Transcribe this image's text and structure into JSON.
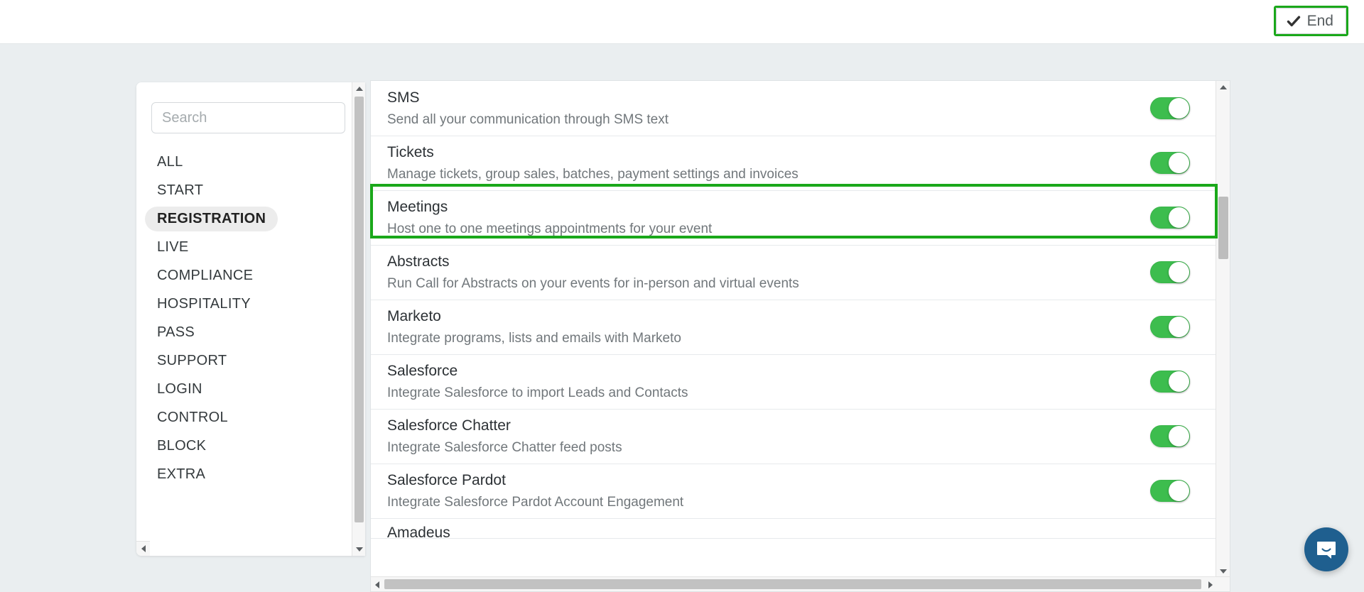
{
  "topbar": {
    "end_button": {
      "label": "End",
      "icon": "check-icon",
      "highlight_color": "#1aa81a"
    }
  },
  "sidebar": {
    "search": {
      "placeholder": "Search",
      "value": ""
    },
    "items": [
      {
        "label": "ALL",
        "active": false
      },
      {
        "label": "START",
        "active": false
      },
      {
        "label": "REGISTRATION",
        "active": true
      },
      {
        "label": "LIVE",
        "active": false
      },
      {
        "label": "COMPLIANCE",
        "active": false
      },
      {
        "label": "HOSPITALITY",
        "active": false
      },
      {
        "label": "PASS",
        "active": false
      },
      {
        "label": "SUPPORT",
        "active": false
      },
      {
        "label": "LOGIN",
        "active": false
      },
      {
        "label": "CONTROL",
        "active": false
      },
      {
        "label": "BLOCK",
        "active": false
      },
      {
        "label": "EXTRA",
        "active": false
      }
    ]
  },
  "main": {
    "rows": [
      {
        "title": "SMS",
        "desc": "Send all your communication through SMS text",
        "toggle": "on",
        "highlighted": false,
        "partial": false
      },
      {
        "title": "Tickets",
        "desc": "Manage tickets, group sales, batches, payment settings and invoices",
        "toggle": "on",
        "highlighted": true,
        "partial": false
      },
      {
        "title": "Meetings",
        "desc": "Host one to one meetings appointments for your event",
        "toggle": "on",
        "highlighted": false,
        "partial": false
      },
      {
        "title": "Abstracts",
        "desc": "Run Call for Abstracts on your events for in-person and virtual events",
        "toggle": "on",
        "highlighted": false,
        "partial": false
      },
      {
        "title": "Marketo",
        "desc": "Integrate programs, lists and emails with Marketo",
        "toggle": "on",
        "highlighted": false,
        "partial": false
      },
      {
        "title": "Salesforce",
        "desc": "Integrate Salesforce to import Leads and Contacts",
        "toggle": "on",
        "highlighted": false,
        "partial": false
      },
      {
        "title": "Salesforce Chatter",
        "desc": "Integrate Salesforce Chatter feed posts",
        "toggle": "on",
        "highlighted": false,
        "partial": false
      },
      {
        "title": "Salesforce Pardot",
        "desc": "Integrate Salesforce Pardot Account Engagement",
        "toggle": "on",
        "highlighted": false,
        "partial": false
      },
      {
        "title": "Amadeus",
        "desc": "",
        "toggle": "on",
        "highlighted": false,
        "partial": true
      }
    ]
  },
  "widgets": {
    "intercom_launcher": "chat-bubble-icon"
  },
  "colors": {
    "toggle_on": "#3dbd4e",
    "highlight_green": "#1aa81a",
    "page_background": "#eaeef0",
    "intercom_blue": "#1f5f8f"
  }
}
